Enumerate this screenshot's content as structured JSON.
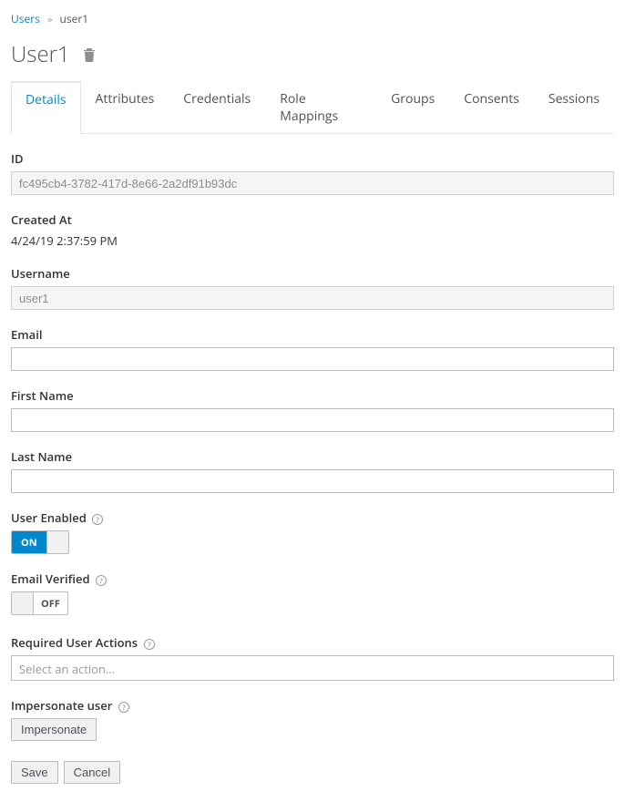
{
  "breadcrumb": {
    "parent": "Users",
    "current": "user1"
  },
  "title": "User1",
  "tabs": [
    {
      "label": "Details",
      "active": true
    },
    {
      "label": "Attributes",
      "active": false
    },
    {
      "label": "Credentials",
      "active": false
    },
    {
      "label": "Role Mappings",
      "active": false
    },
    {
      "label": "Groups",
      "active": false
    },
    {
      "label": "Consents",
      "active": false
    },
    {
      "label": "Sessions",
      "active": false
    }
  ],
  "fields": {
    "id": {
      "label": "ID",
      "value": "fc495cb4-3782-417d-8e66-2a2df91b93dc"
    },
    "created_at": {
      "label": "Created At",
      "value": "4/24/19 2:37:59 PM"
    },
    "username": {
      "label": "Username",
      "value": "user1"
    },
    "email": {
      "label": "Email",
      "value": ""
    },
    "first_name": {
      "label": "First Name",
      "value": ""
    },
    "last_name": {
      "label": "Last Name",
      "value": ""
    },
    "user_enabled": {
      "label": "User Enabled",
      "state": "ON"
    },
    "email_verified": {
      "label": "Email Verified",
      "state": "OFF"
    },
    "required_actions": {
      "label": "Required User Actions",
      "placeholder": "Select an action..."
    },
    "impersonate": {
      "label": "Impersonate user",
      "button": "Impersonate"
    }
  },
  "buttons": {
    "save": "Save",
    "cancel": "Cancel"
  }
}
